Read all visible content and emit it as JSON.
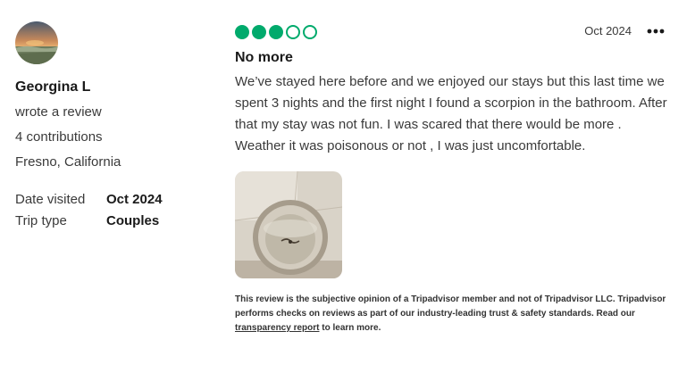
{
  "reviewer": {
    "name": "Georgina L",
    "action": "wrote a review",
    "contributions": "4 contributions",
    "location": "Fresno, California",
    "avatar_icon": "profile-photo-sunset"
  },
  "trip": {
    "date_visited_label": "Date visited",
    "date_visited_value": "Oct 2024",
    "trip_type_label": "Trip type",
    "trip_type_value": "Couples"
  },
  "review": {
    "rating": 3,
    "rating_max": 5,
    "rating_color": "#00aa6c",
    "date": "Oct 2024",
    "more_icon": "ellipsis-icon",
    "title": "No more",
    "text": "We’ve stayed here before and we enjoyed our stays but this last time we spent 3 nights and the first night I found a scorpion in the bathroom.  After that my stay was not fun.  I was scared that there would be more .  Weather it was poisonous or not , I was just uncomfortable.",
    "photo_icon": "review-photo-glass"
  },
  "disclaimer": {
    "text_before": "This review is the subjective opinion of a Tripadvisor member and not of Tripadvisor LLC. Tripadvisor performs checks on reviews as part of our industry-leading trust & safety standards. Read our ",
    "link": "transparency report",
    "text_after": " to learn more."
  }
}
